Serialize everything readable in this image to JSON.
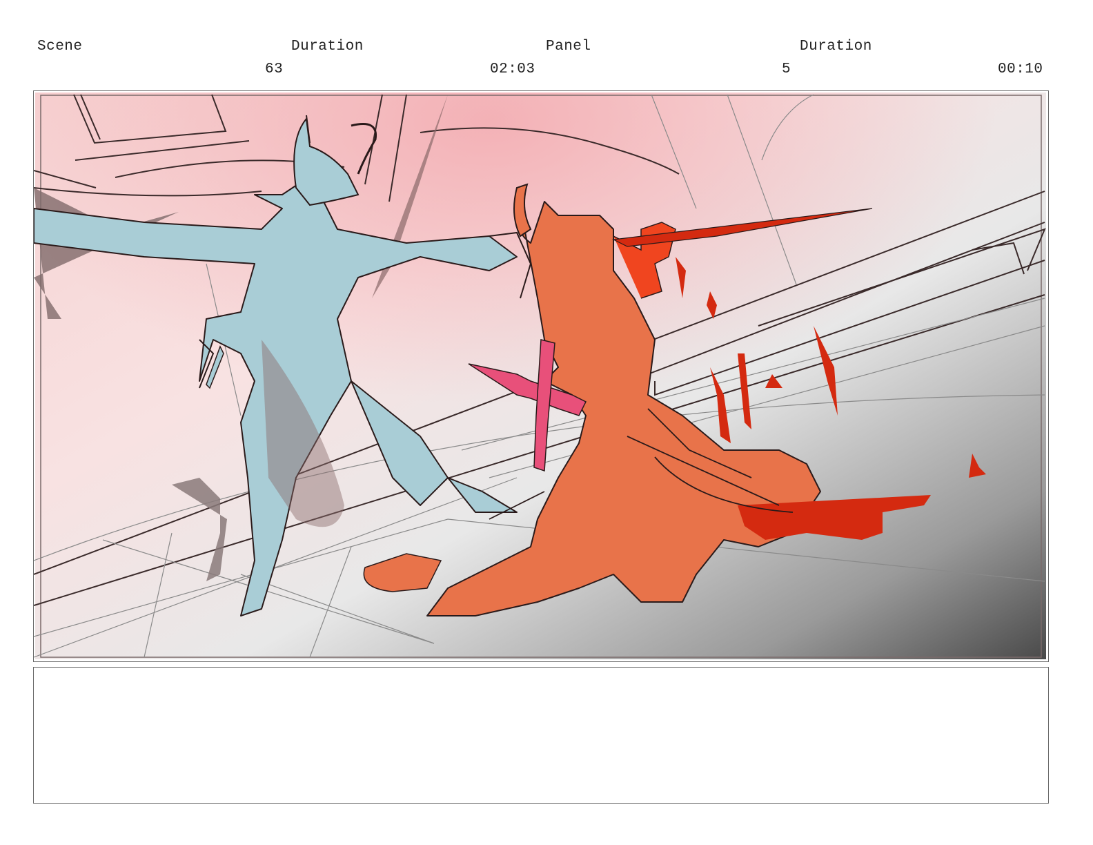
{
  "header": {
    "scene_label": "Scene",
    "scene_duration_label": "Duration",
    "panel_label": "Panel",
    "panel_duration_label": "Duration",
    "scene_value": "63",
    "scene_duration_value": "02:03",
    "panel_value": "5",
    "panel_duration_value": "00:10"
  },
  "colors": {
    "demon_figure": "#a9cdd6",
    "kneeling_figure": "#e8734a",
    "sword": "#e8507a",
    "blood": "#d42a10",
    "ink": "#2a1a1a",
    "background_pink": "#f4c4c6",
    "background_gray": "#555555"
  },
  "notes": {
    "text": ""
  }
}
